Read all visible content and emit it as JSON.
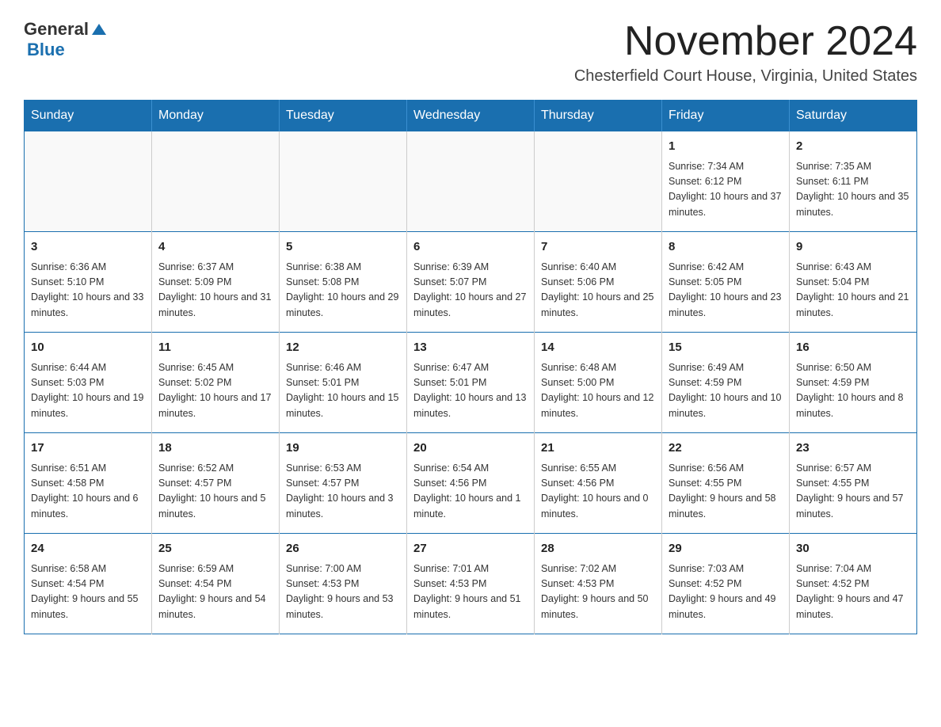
{
  "logo": {
    "general": "General",
    "blue": "Blue"
  },
  "title": "November 2024",
  "subtitle": "Chesterfield Court House, Virginia, United States",
  "days_of_week": [
    "Sunday",
    "Monday",
    "Tuesday",
    "Wednesday",
    "Thursday",
    "Friday",
    "Saturday"
  ],
  "weeks": [
    [
      {
        "day": "",
        "info": ""
      },
      {
        "day": "",
        "info": ""
      },
      {
        "day": "",
        "info": ""
      },
      {
        "day": "",
        "info": ""
      },
      {
        "day": "",
        "info": ""
      },
      {
        "day": "1",
        "info": "Sunrise: 7:34 AM\nSunset: 6:12 PM\nDaylight: 10 hours and 37 minutes."
      },
      {
        "day": "2",
        "info": "Sunrise: 7:35 AM\nSunset: 6:11 PM\nDaylight: 10 hours and 35 minutes."
      }
    ],
    [
      {
        "day": "3",
        "info": "Sunrise: 6:36 AM\nSunset: 5:10 PM\nDaylight: 10 hours and 33 minutes."
      },
      {
        "day": "4",
        "info": "Sunrise: 6:37 AM\nSunset: 5:09 PM\nDaylight: 10 hours and 31 minutes."
      },
      {
        "day": "5",
        "info": "Sunrise: 6:38 AM\nSunset: 5:08 PM\nDaylight: 10 hours and 29 minutes."
      },
      {
        "day": "6",
        "info": "Sunrise: 6:39 AM\nSunset: 5:07 PM\nDaylight: 10 hours and 27 minutes."
      },
      {
        "day": "7",
        "info": "Sunrise: 6:40 AM\nSunset: 5:06 PM\nDaylight: 10 hours and 25 minutes."
      },
      {
        "day": "8",
        "info": "Sunrise: 6:42 AM\nSunset: 5:05 PM\nDaylight: 10 hours and 23 minutes."
      },
      {
        "day": "9",
        "info": "Sunrise: 6:43 AM\nSunset: 5:04 PM\nDaylight: 10 hours and 21 minutes."
      }
    ],
    [
      {
        "day": "10",
        "info": "Sunrise: 6:44 AM\nSunset: 5:03 PM\nDaylight: 10 hours and 19 minutes."
      },
      {
        "day": "11",
        "info": "Sunrise: 6:45 AM\nSunset: 5:02 PM\nDaylight: 10 hours and 17 minutes."
      },
      {
        "day": "12",
        "info": "Sunrise: 6:46 AM\nSunset: 5:01 PM\nDaylight: 10 hours and 15 minutes."
      },
      {
        "day": "13",
        "info": "Sunrise: 6:47 AM\nSunset: 5:01 PM\nDaylight: 10 hours and 13 minutes."
      },
      {
        "day": "14",
        "info": "Sunrise: 6:48 AM\nSunset: 5:00 PM\nDaylight: 10 hours and 12 minutes."
      },
      {
        "day": "15",
        "info": "Sunrise: 6:49 AM\nSunset: 4:59 PM\nDaylight: 10 hours and 10 minutes."
      },
      {
        "day": "16",
        "info": "Sunrise: 6:50 AM\nSunset: 4:59 PM\nDaylight: 10 hours and 8 minutes."
      }
    ],
    [
      {
        "day": "17",
        "info": "Sunrise: 6:51 AM\nSunset: 4:58 PM\nDaylight: 10 hours and 6 minutes."
      },
      {
        "day": "18",
        "info": "Sunrise: 6:52 AM\nSunset: 4:57 PM\nDaylight: 10 hours and 5 minutes."
      },
      {
        "day": "19",
        "info": "Sunrise: 6:53 AM\nSunset: 4:57 PM\nDaylight: 10 hours and 3 minutes."
      },
      {
        "day": "20",
        "info": "Sunrise: 6:54 AM\nSunset: 4:56 PM\nDaylight: 10 hours and 1 minute."
      },
      {
        "day": "21",
        "info": "Sunrise: 6:55 AM\nSunset: 4:56 PM\nDaylight: 10 hours and 0 minutes."
      },
      {
        "day": "22",
        "info": "Sunrise: 6:56 AM\nSunset: 4:55 PM\nDaylight: 9 hours and 58 minutes."
      },
      {
        "day": "23",
        "info": "Sunrise: 6:57 AM\nSunset: 4:55 PM\nDaylight: 9 hours and 57 minutes."
      }
    ],
    [
      {
        "day": "24",
        "info": "Sunrise: 6:58 AM\nSunset: 4:54 PM\nDaylight: 9 hours and 55 minutes."
      },
      {
        "day": "25",
        "info": "Sunrise: 6:59 AM\nSunset: 4:54 PM\nDaylight: 9 hours and 54 minutes."
      },
      {
        "day": "26",
        "info": "Sunrise: 7:00 AM\nSunset: 4:53 PM\nDaylight: 9 hours and 53 minutes."
      },
      {
        "day": "27",
        "info": "Sunrise: 7:01 AM\nSunset: 4:53 PM\nDaylight: 9 hours and 51 minutes."
      },
      {
        "day": "28",
        "info": "Sunrise: 7:02 AM\nSunset: 4:53 PM\nDaylight: 9 hours and 50 minutes."
      },
      {
        "day": "29",
        "info": "Sunrise: 7:03 AM\nSunset: 4:52 PM\nDaylight: 9 hours and 49 minutes."
      },
      {
        "day": "30",
        "info": "Sunrise: 7:04 AM\nSunset: 4:52 PM\nDaylight: 9 hours and 47 minutes."
      }
    ]
  ]
}
